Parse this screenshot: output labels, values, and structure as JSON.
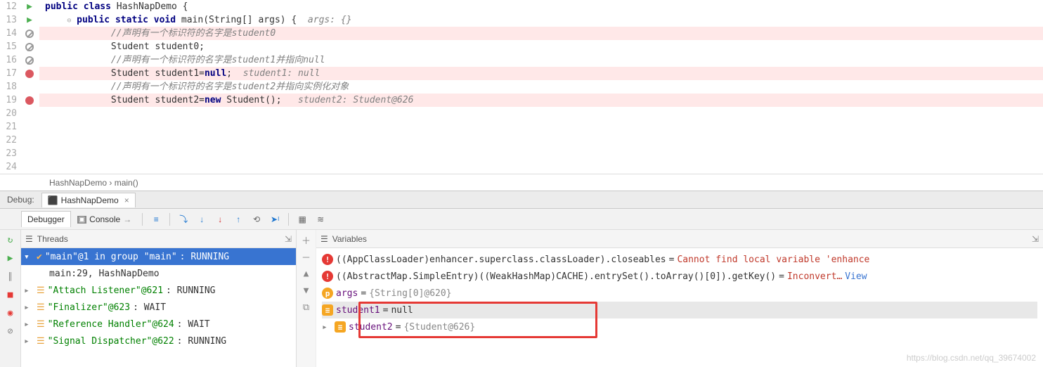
{
  "editor": {
    "lines": [
      "12",
      "13",
      "14",
      "15",
      "16",
      "17",
      "18",
      "19",
      "20",
      "21",
      "22",
      "23",
      "24"
    ],
    "code": {
      "l12": {
        "kw": "public class ",
        "cls": "HashNapDemo {"
      },
      "l13": {
        "kw": "public static void ",
        "fn": "main(String[] args) {",
        "ann": "args: {}"
      },
      "l14": "//声明有一个标识符的名字是student0",
      "l15": {
        "t": "Student student0;"
      },
      "l16": "//声明有一个标识符的名字是student1并指向null",
      "l17": {
        "a": "Student student1=",
        "kw": "null",
        "b": ";",
        "ann": "student1: null"
      },
      "l18": "//声明有一个标识符的名字是student2并指向实例化对象",
      "l19": {
        "a": "Student student2=",
        "kw": "new",
        "b": " Student();",
        "ann": "student2: Student@626"
      }
    }
  },
  "breadcrumb": {
    "cls": "HashNapDemo",
    "sep": " › ",
    "fn": "main()"
  },
  "debugHeader": {
    "label": "Debug:",
    "tab": "HashNapDemo"
  },
  "toolTabs": {
    "debugger": "Debugger",
    "console": "Console"
  },
  "threadsPanel": {
    "title": "Threads",
    "rows": [
      {
        "sel": true,
        "expanded": true,
        "name": "\"main\"@1 in group \"main\"",
        "state": ": RUNNING",
        "check": true
      },
      {
        "frame": true,
        "text": "main:29, HashNapDemo"
      },
      {
        "name": "\"Attach Listener\"@621",
        "state": ": RUNNING"
      },
      {
        "name": "\"Finalizer\"@623",
        "state": ": WAIT"
      },
      {
        "name": "\"Reference Handler\"@624",
        "state": ": WAIT"
      },
      {
        "name": "\"Signal Dispatcher\"@622",
        "state": ": RUNNING"
      }
    ]
  },
  "varsPanel": {
    "title": "Variables",
    "rows": [
      {
        "type": "err",
        "expr": "((AppClassLoader)enhancer.superclass.classLoader).closeables",
        "eq": " = ",
        "val": "Cannot find local variable 'enhance",
        "red": true
      },
      {
        "type": "err",
        "expr": "((AbstractMap.SimpleEntry)((WeakHashMap)CACHE).entrySet().toArray()[0]).getKey()",
        "eq": " = ",
        "val": "Inconvert…",
        "red": true,
        "view": " View"
      },
      {
        "type": "p",
        "name": "args",
        "eq": " = ",
        "val": "{String[0]@620}"
      },
      {
        "type": "f",
        "name": "student1",
        "eq": " = ",
        "val": "null",
        "plain": true,
        "sel": true
      },
      {
        "type": "f",
        "name": "student2",
        "eq": " = ",
        "val": "{Student@626}",
        "expand": true
      }
    ]
  },
  "watermark": "https://blog.csdn.net/qq_39674002"
}
